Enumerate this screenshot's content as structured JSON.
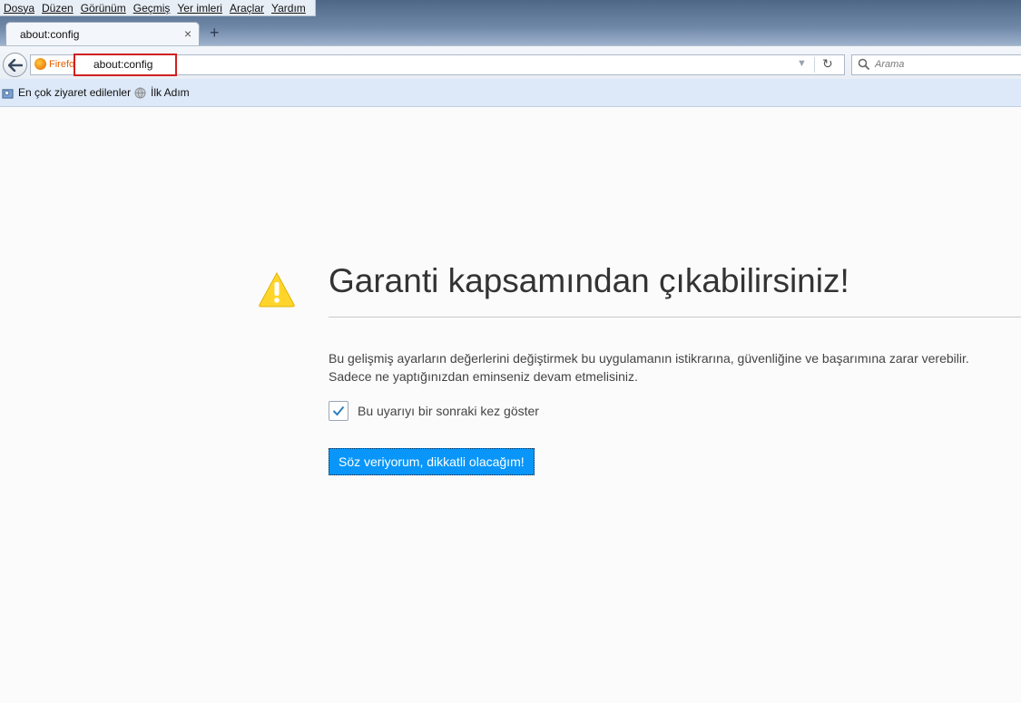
{
  "menu": [
    "Dosya",
    "Düzen",
    "Görünüm",
    "Geçmiş",
    "Yer imleri",
    "Araçlar",
    "Yardım"
  ],
  "tab": {
    "title": "about:config",
    "close": "×",
    "new_tab": "+"
  },
  "navbar": {
    "identity_label": "Firefox",
    "url": "about:config",
    "search_placeholder": "Arama"
  },
  "bookmarks": [
    {
      "label": "En çok ziyaret edilenler",
      "icon": "bookmark-folder-icon"
    },
    {
      "label": "İlk Adım",
      "icon": "globe-icon"
    }
  ],
  "content": {
    "heading": "Garanti kapsamından çıkabilirsiniz!",
    "line1": "Bu gelişmiş ayarların değerlerini değiştirmek bu uygulamanın istikrarına, güvenliğine ve başarımına zarar verebilir.",
    "line2": "Sadece ne yaptığınızdan eminseniz devam etmelisiniz.",
    "checkbox_label": "Bu uyarıyı bir sonraki kez göster",
    "checkbox_checked": true,
    "button_label": "Söz veriyorum, dikkatli olacağım!"
  },
  "colors": {
    "accent_button": "#0996f8",
    "warning_icon": "#ffd52c",
    "highlight_box": "#d12020"
  }
}
